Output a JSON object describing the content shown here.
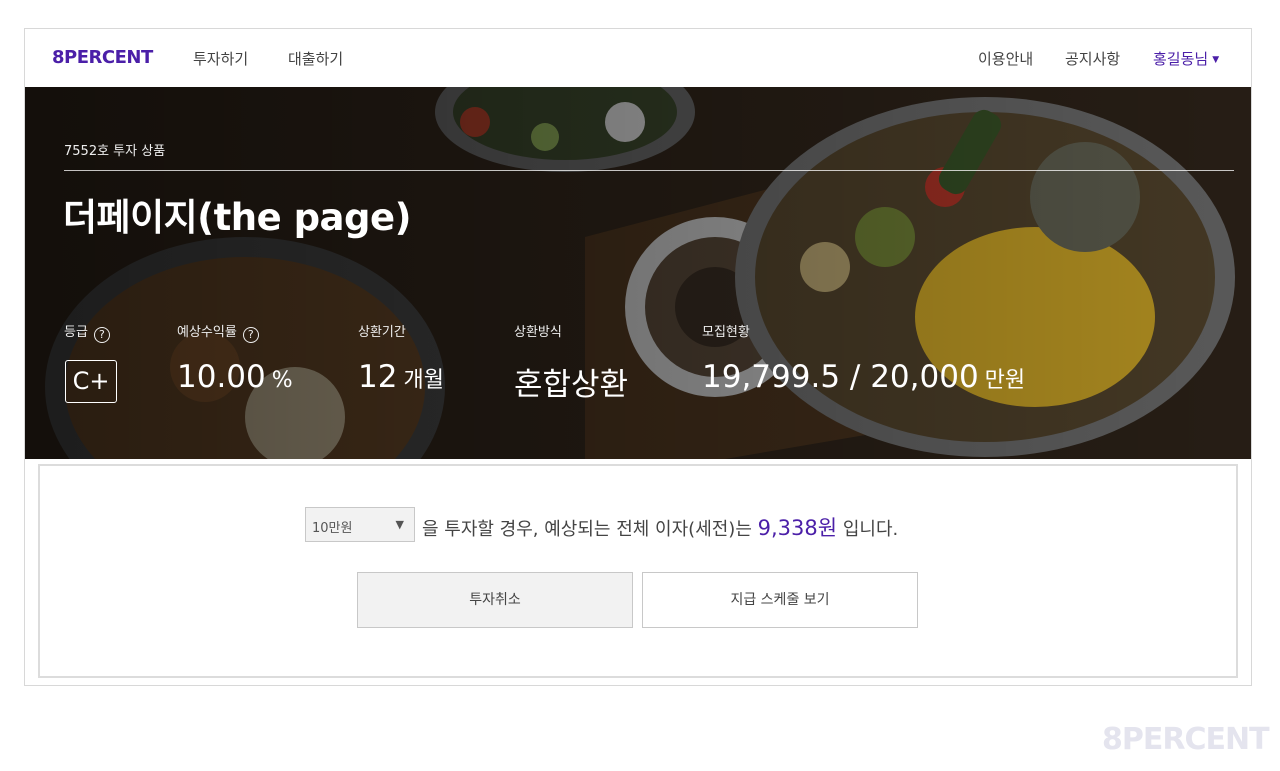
{
  "brand": {
    "logo": "8PERCENT",
    "brand_color": "#4b1fa8"
  },
  "nav": {
    "left": [
      "투자하기",
      "대출하기"
    ],
    "right": [
      "이용안내",
      "공지사항"
    ],
    "user": "홍길동님"
  },
  "product": {
    "subtitle": "7552호 투자 상품",
    "title": "더페이지(the page)",
    "stats": {
      "grade": {
        "label": "등급",
        "value": "C+"
      },
      "rate": {
        "label": "예상수익률",
        "value": "10.00",
        "unit": "%"
      },
      "period": {
        "label": "상환기간",
        "value": "12",
        "unit": "개월"
      },
      "method": {
        "label": "상환방식",
        "value": "혼합상환"
      },
      "funding": {
        "label": "모집현황",
        "value": "19,799.5 / 20,000",
        "unit": "만원"
      }
    },
    "help_icon": "?"
  },
  "calculator": {
    "selected_amount": "10만원",
    "text_before": "을 투자할 경우, 예상되는 전체 이자(세전)는",
    "interest": "9,338원",
    "text_after": "입니다."
  },
  "buttons": {
    "cancel": "투자취소",
    "schedule": "지급 스케줄 보기"
  },
  "watermark": "8PERCENT"
}
